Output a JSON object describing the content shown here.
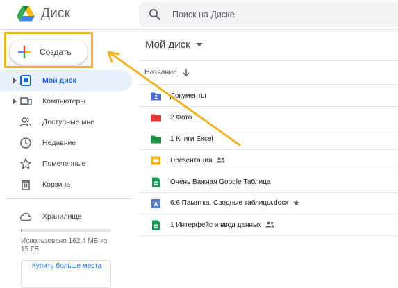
{
  "header": {
    "app_name": "Диск",
    "search_placeholder": "Поиск на Диске"
  },
  "sidebar": {
    "create_label": "Создать",
    "items": [
      {
        "label": "Мой диск",
        "icon": "drive-icon",
        "active": true,
        "has_caret": true
      },
      {
        "label": "Компьютеры",
        "icon": "computer-icon",
        "active": false,
        "has_caret": true
      },
      {
        "label": "Доступные мне",
        "icon": "shared-people-icon",
        "active": false,
        "has_caret": false
      },
      {
        "label": "Недавние",
        "icon": "clock-icon",
        "active": false,
        "has_caret": false
      },
      {
        "label": "Помеченные",
        "icon": "star-outline-icon",
        "active": false,
        "has_caret": false
      },
      {
        "label": "Корзина",
        "icon": "trash-icon",
        "active": false,
        "has_caret": false
      }
    ],
    "storage": {
      "label": "Хранилище",
      "used_text": "Использовано 162,4 МБ из 15 ГБ",
      "used_fraction": 0.011,
      "buy_label": "Купить больше места"
    }
  },
  "main": {
    "title": "Мой диск",
    "column_name": "Название",
    "files": [
      {
        "name": "Документы",
        "type": "shared-folder",
        "color": "#4a6fd8"
      },
      {
        "name": "2 Фото",
        "type": "folder",
        "color": "#e53935"
      },
      {
        "name": "1 Книги Excel",
        "type": "folder",
        "color": "#1e8e3e"
      },
      {
        "name": "Презентация",
        "type": "slides",
        "color": "#f4b400",
        "shared": true
      },
      {
        "name": "Очень Важная Google Таблица",
        "type": "sheets",
        "color": "#0f9d58"
      },
      {
        "name": "6.6 Памятка. Сводные таблицы.docx",
        "type": "word",
        "color": "#4a77c4",
        "starred": true
      },
      {
        "name": "1 Интерфейс и ввод данных",
        "type": "sheets",
        "color": "#0f9d58",
        "shared": true
      }
    ]
  },
  "colors": {
    "accent": "#1a73e8",
    "highlight": "#f0b429",
    "active_bg": "#e8f0fe"
  }
}
